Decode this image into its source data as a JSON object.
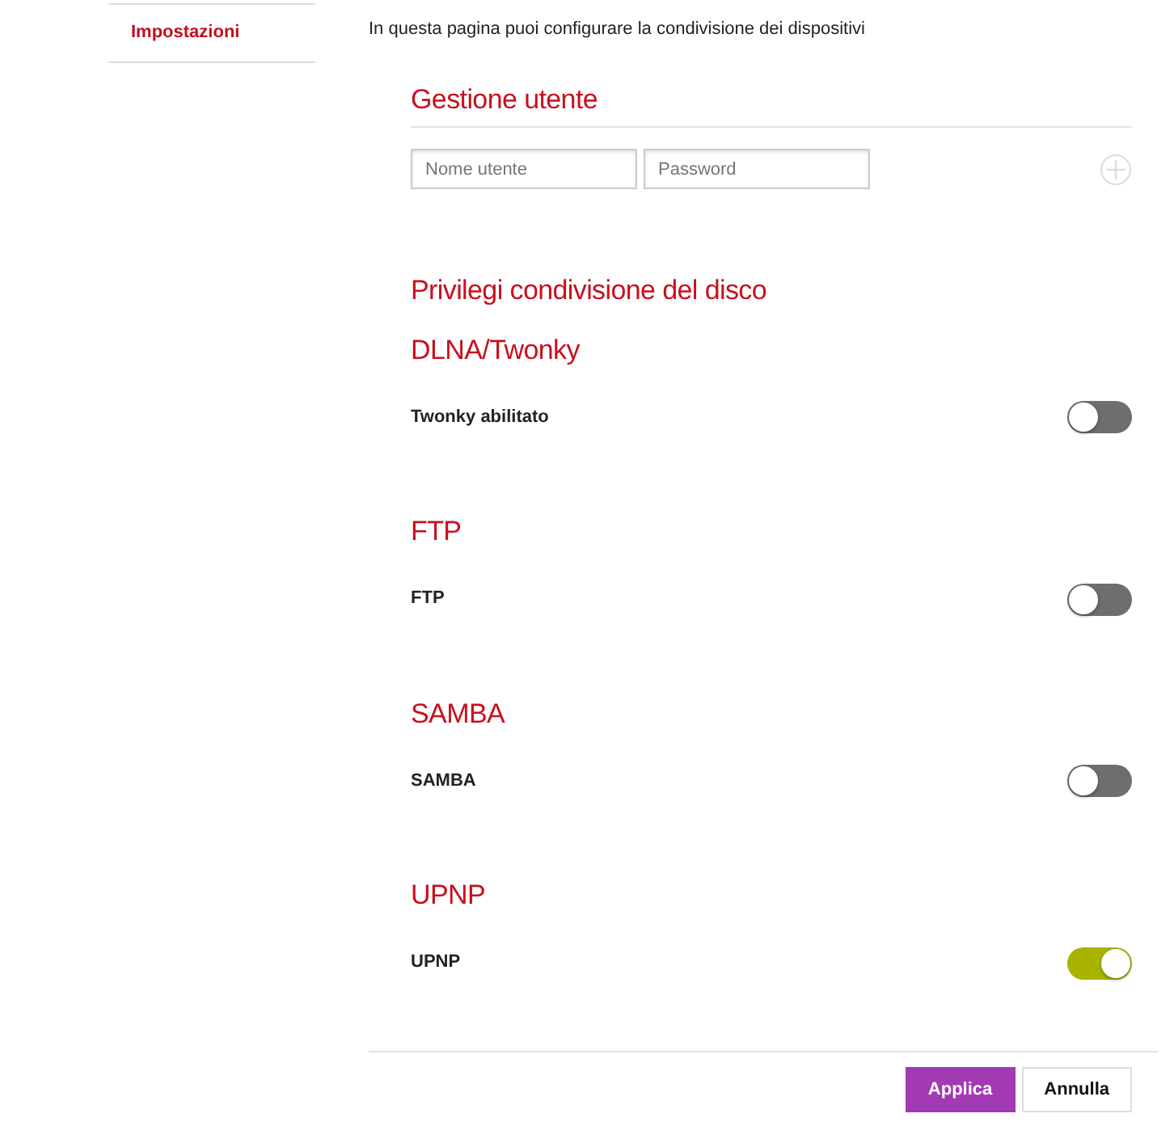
{
  "sidebar": {
    "items": [
      {
        "label": "Impostazioni",
        "selected": true
      }
    ]
  },
  "intro": "In questa pagina puoi configurare la condivisione dei dispositivi",
  "user_management": {
    "title": "Gestione utente",
    "username": {
      "placeholder": "Nome utente"
    },
    "password": {
      "placeholder": "Password"
    }
  },
  "privileges_title": "Privilegi condivisione del disco",
  "services": [
    {
      "title": "DLNA/Twonky",
      "label": "Twonky abilitato",
      "on": false
    },
    {
      "title": "FTP",
      "label": "FTP",
      "on": false
    },
    {
      "title": "SAMBA",
      "label": "SAMBA",
      "on": false
    },
    {
      "title": "UPNP",
      "label": "UPNP",
      "on": true
    }
  ],
  "buttons": [
    {
      "label": "Applica",
      "kind": "primary"
    },
    {
      "label": "Annulla",
      "kind": "secondary"
    }
  ]
}
